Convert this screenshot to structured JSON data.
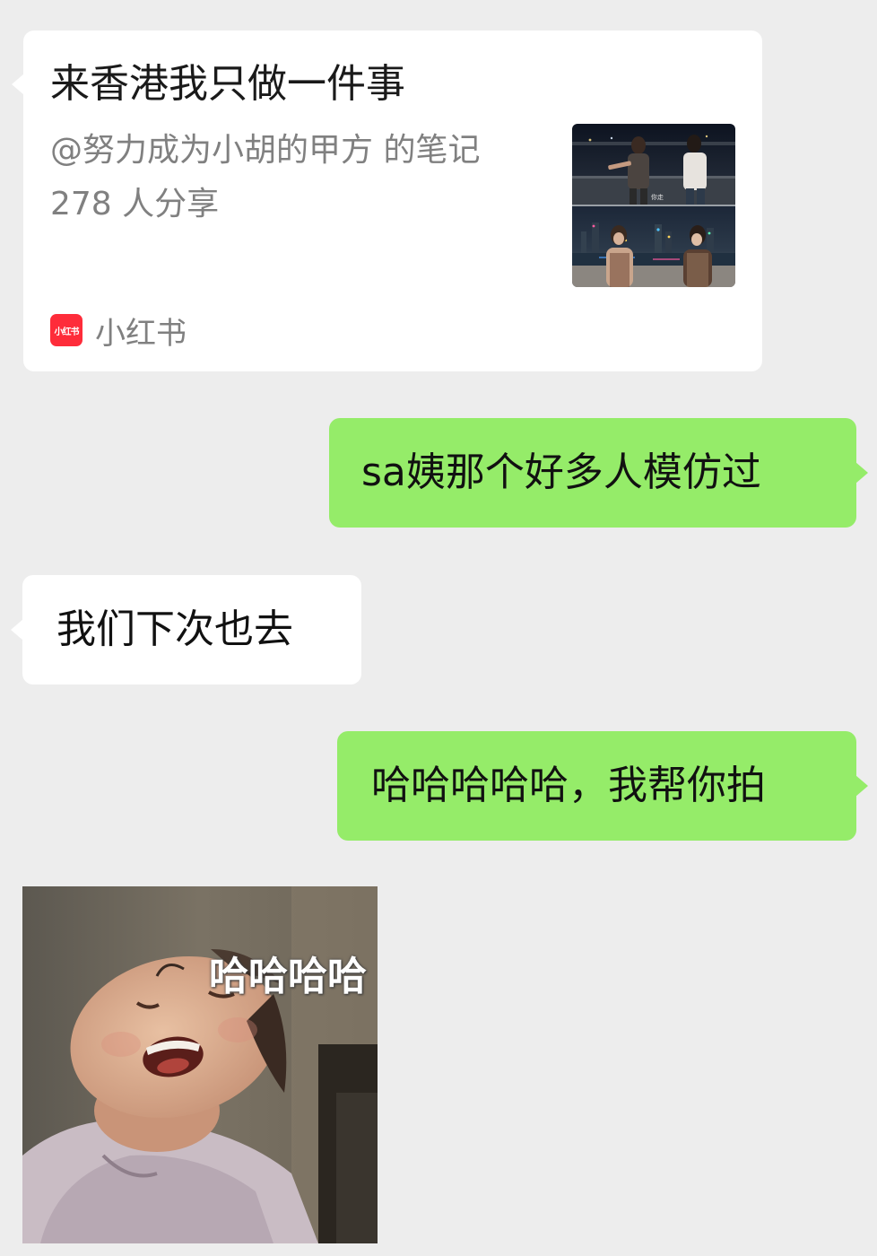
{
  "link_card": {
    "title": "来香港我只做一件事",
    "author_line": "@努力成为小胡的甲方 的笔记",
    "share_count": "278 人分享",
    "source_logo_text": "小红书",
    "source_name": "小红书",
    "thumb_top_caption": "你走",
    "brand_color": "#fe2c3a"
  },
  "messages": [
    {
      "direction": "outgoing",
      "text": "sa姨那个好多人模仿过"
    },
    {
      "direction": "incoming",
      "text": "我们下次也去"
    },
    {
      "direction": "outgoing",
      "text": "哈哈哈哈哈，我帮你拍"
    }
  ],
  "sticker": {
    "caption": "哈哈哈哈"
  },
  "colors": {
    "background": "#ededed",
    "outgoing_bubble": "#95ec69",
    "incoming_bubble": "#ffffff"
  }
}
